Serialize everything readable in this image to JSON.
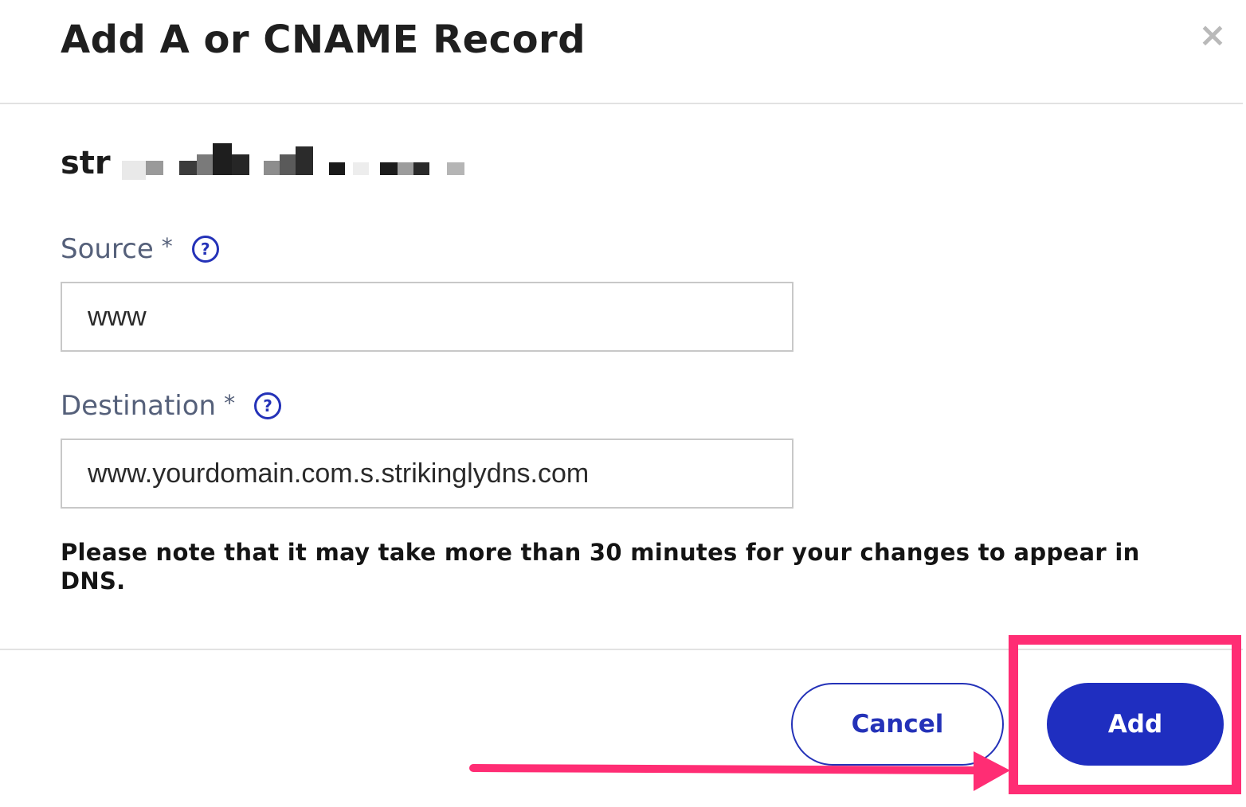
{
  "dialog": {
    "title": "Add A or CNAME Record",
    "close_symbol": "×"
  },
  "domain": {
    "visible_prefix": "str"
  },
  "fields": {
    "source": {
      "label": "Source",
      "required_mark": "*",
      "help_symbol": "?",
      "value": "www"
    },
    "destination": {
      "label": "Destination",
      "required_mark": "*",
      "help_symbol": "?",
      "value": "www.yourdomain.com.s.strikinglydns.com"
    }
  },
  "note": "Please note that it may take more than 30 minutes for your changes to appear in DNS.",
  "buttons": {
    "cancel": "Cancel",
    "add": "Add"
  },
  "colors": {
    "primary": "#1f2ec0",
    "highlight": "#ff2d74",
    "label": "#55607a"
  }
}
